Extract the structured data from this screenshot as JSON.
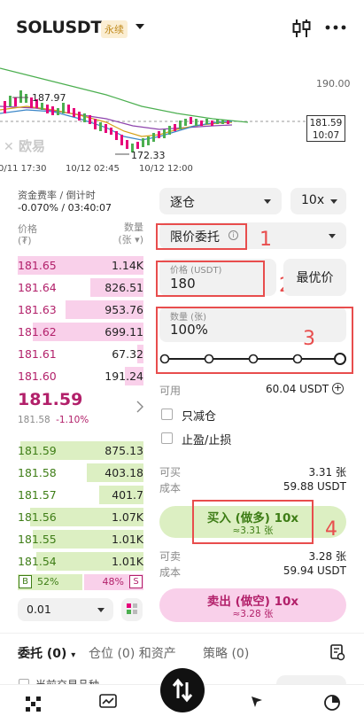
{
  "header": {
    "symbol": "SOLUSDT",
    "contract_tag": "永续",
    "chart_icon": "candlestick-icon",
    "more_icon": "more-icon"
  },
  "chart": {
    "price_high_label": "187.97",
    "price_low_label": "172.33",
    "axis_price_top": "190.00",
    "current_price_box": "181.59",
    "countdown_box": "10:07",
    "watermark": "欧易",
    "time_labels": [
      "0/11 17:30",
      "10/12 02:45",
      "10/12 12:00"
    ]
  },
  "funding": {
    "label": "资金费率 / 倒计时",
    "value": "-0.070% / 03:40:07"
  },
  "book_header": {
    "price_label": "价格",
    "price_unit": "(₮)",
    "qty_label": "数量",
    "qty_unit": "(张 ▾)"
  },
  "asks": [
    {
      "price": "181.65",
      "qty": "1.14K",
      "fill": 1.0
    },
    {
      "price": "181.64",
      "qty": "826.51",
      "fill": 0.42
    },
    {
      "price": "181.63",
      "qty": "953.76",
      "fill": 0.62
    },
    {
      "price": "181.62",
      "qty": "699.11",
      "fill": 0.88
    },
    {
      "price": "181.61",
      "qty": "67.32",
      "fill": 0.05
    },
    {
      "price": "181.60",
      "qty": "191.24",
      "fill": 0.15
    }
  ],
  "last_price": {
    "price": "181.59",
    "mark": "181.58",
    "change": "-1.10%"
  },
  "bids": [
    {
      "price": "181.59",
      "qty": "875.13",
      "fill": 0.98
    },
    {
      "price": "181.58",
      "qty": "403.18",
      "fill": 0.45
    },
    {
      "price": "181.57",
      "qty": "401.7",
      "fill": 0.35
    },
    {
      "price": "181.56",
      "qty": "1.07K",
      "fill": 0.9
    },
    {
      "price": "181.55",
      "qty": "1.01K",
      "fill": 0.88
    },
    {
      "price": "181.54",
      "qty": "1.01K",
      "fill": 0.85
    }
  ],
  "ratio": {
    "buy_badge": "B",
    "buy_pct": "52%",
    "sell_pct": "48%",
    "sell_badge": "S",
    "buy_fraction": 0.52
  },
  "depth_select": {
    "value": "0.01"
  },
  "order_form": {
    "margin_mode": "逐仓",
    "leverage": "10x",
    "order_type": "限价委托",
    "price_label": "价格 (USDT)",
    "price_value": "180",
    "best_price": "最优价",
    "amount_label": "数量 (张)",
    "amount_value": "100%",
    "slider_fraction": 1.0,
    "available_label": "可用",
    "available_value": "60.04 USDT",
    "reduce_only": "只减仓",
    "tp_sl": "止盈/止损",
    "buy_max_label": "可买",
    "buy_max_value": "3.31 张",
    "buy_cost_label": "成本",
    "buy_cost_value": "59.88 USDT",
    "buy_button": "买入 (做多) 10x",
    "buy_sub": "≈3.31 张",
    "sell_max_label": "可卖",
    "sell_max_value": "3.28 张",
    "sell_cost_label": "成本",
    "sell_cost_value": "59.94 USDT",
    "sell_button": "卖出 (做空) 10x",
    "sell_sub": "≈3.28 张"
  },
  "annotations": [
    "1",
    "2",
    "3",
    "4"
  ],
  "bottom_tabs": {
    "orders": "委托 (0)",
    "positions": "仓位 (0) 和资产",
    "strategy": "策略 (0)",
    "current_only": "当前交易品种"
  },
  "colors": {
    "buy": "#3e7d16",
    "sell": "#b2206a",
    "annotation": "#e84d4d"
  }
}
